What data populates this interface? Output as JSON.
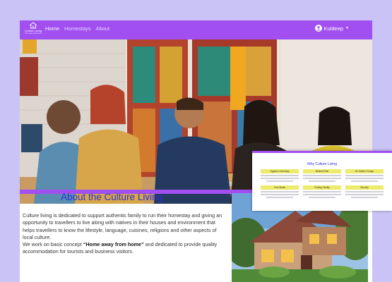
{
  "brand": {
    "name": "Culture Living",
    "tagline": "Homestay experience"
  },
  "nav": {
    "links": [
      "Home",
      "Homestays",
      "About"
    ],
    "user_name": "Kuldeep"
  },
  "about": {
    "title": "About the Culture Living",
    "paragraph_1": "Culture living is dedicated to support authentic family to run their homestay and giving an opportunity to travellers to live along with natives in their houses and environment that helps travellers to know the lifestyle, language, cuisines, religions and other aspects of local culture.",
    "paragraph_2_before": "We work on basic concept ",
    "paragraph_2_bold": "“Home away from home”",
    "paragraph_2_after": " and dedicated to provide quality accommodation for tourists and business visitors."
  },
  "why": {
    "title": "Why Culture Living",
    "cards": [
      "Hygienic Homestay",
      "Minimal Rate",
      "No Hidden Charge",
      "Free Meals",
      "Finding Facility",
      "Security"
    ]
  },
  "colors": {
    "accent": "#a14ff0",
    "title": "#2a31d8",
    "card_head": "#eeea6a",
    "background": "#c9c4f5"
  },
  "icons": [
    "house-logo-icon",
    "user-circle-icon",
    "caret-down-icon"
  ]
}
